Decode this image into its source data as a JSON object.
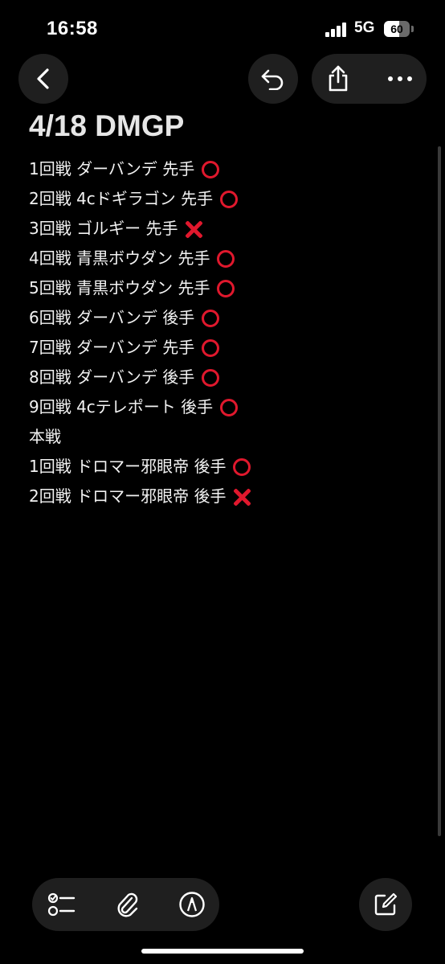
{
  "status_bar": {
    "time": "16:58",
    "network": "5G",
    "battery_percent": "60",
    "battery_level": 0.6
  },
  "nav": {
    "back_icon": "chevron-left-icon",
    "undo_icon": "undo-icon",
    "share_icon": "share-icon",
    "more_icon": "ellipsis-icon"
  },
  "note": {
    "title": "4/18 DMGP",
    "lines": [
      {
        "text": "1回戦 ダーバンデ 先手",
        "mark": "ok"
      },
      {
        "text": "2回戦 4cドギラゴン 先手",
        "mark": "ok"
      },
      {
        "text": "3回戦 ゴルギー 先手",
        "mark": "ng"
      },
      {
        "text": "4回戦 青黒ボウダン 先手",
        "mark": "ok"
      },
      {
        "text": "5回戦 青黒ボウダン 先手",
        "mark": "ok"
      },
      {
        "text": "6回戦 ダーバンデ 後手",
        "mark": "ok"
      },
      {
        "text": "7回戦 ダーバンデ 先手",
        "mark": "ok"
      },
      {
        "text": "8回戦 ダーバンデ 後手",
        "mark": "ok"
      },
      {
        "text": "9回戦 4cテレポート 後手",
        "mark": "ok"
      },
      {
        "text": "本戦",
        "mark": ""
      },
      {
        "text": "1回戦 ドロマー邪眼帝 後手",
        "mark": "ok"
      },
      {
        "text": "2回戦 ドロマー邪眼帝 後手",
        "mark": "ng"
      }
    ]
  },
  "toolbar": {
    "checklist_icon": "checklist-icon",
    "attach_icon": "paperclip-icon",
    "markup_icon": "pen-markup-icon",
    "compose_icon": "compose-icon"
  },
  "colors": {
    "background": "#000000",
    "button_bg": "#1f1f1f",
    "mark_red": "#e0182d"
  }
}
